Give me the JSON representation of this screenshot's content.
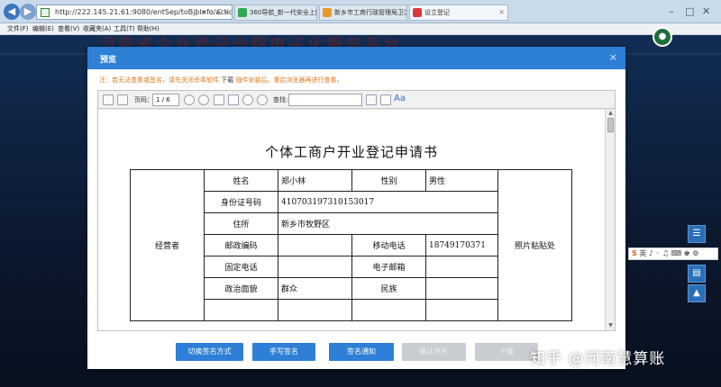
{
  "browser": {
    "address": "http://222.145.21.61:9080/entSep/toBjbInfo/action?",
    "address_tools": "ρ ▾ ☆ C ×",
    "tabs": [
      {
        "label": "360导航_新一代安全上网导航"
      },
      {
        "label": "新乡市工商行政管理局卫滨分..."
      },
      {
        "label": "设立登记"
      }
    ],
    "menu": [
      "文件(F)",
      "编辑(E)",
      "查看(V)",
      "收藏夹(A)",
      "工具(T)",
      "帮助(H)"
    ]
  },
  "background": {
    "site_title": "河南省企业登记全程电子化服务平台"
  },
  "modal": {
    "title": "预览",
    "close": "×",
    "notice_prefix": "注：若无法查看或签名，请先关闭杀毒软件",
    "notice_download": "下载",
    "notice_suffix": "插件安装后，重启浏览器再进行查看。",
    "viewer": {
      "page_label": "页码：",
      "page_value": "1 / 6",
      "search_label": "查找:",
      "aa_label": "Aa"
    },
    "document": {
      "title": "个体工商户开业登记申请书",
      "operator_label": "经营者",
      "photo_label": "照片粘贴处",
      "name_label": "姓名",
      "name_value": "郑小林",
      "gender_label": "性别",
      "gender_value": "男性",
      "id_label": "身份证号码",
      "id_value": "410703197310153017",
      "address_label": "住所",
      "address_value": "新乡市牧野区",
      "postcode_label": "邮政编码",
      "postcode_value": "",
      "mobile_label": "移动电话",
      "mobile_value": "18749170371",
      "phone_label": "固定电话",
      "phone_value": "",
      "email_label": "电子邮箱",
      "email_value": "",
      "political_label": "政治面貌",
      "political_value": "群众",
      "ethnic_label": "民族",
      "ethnic_value": ""
    },
    "buttons": {
      "switch_sign": "切换签名方式",
      "handwrite_sign": "手写签名",
      "sign_notice": "签名通知",
      "disabled_1": "确认签名",
      "disabled_2": "下载"
    }
  },
  "ime_bar": {
    "text": "英 ♪ ◦ ♫ ⌨ ♚ ⚙"
  },
  "watermark": "知乎 @河南慧算账"
}
